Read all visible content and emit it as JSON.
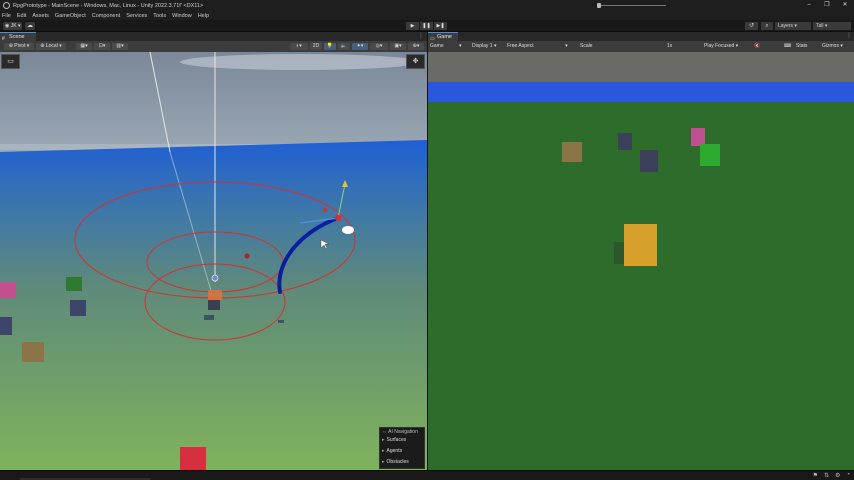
{
  "window": {
    "title": "RpgPrototype - MainScene - Windows, Mac, Linux - Unity 2022.3.71f' <DX11>"
  },
  "menu": [
    "File",
    "Edit",
    "Assets",
    "GameObject",
    "Component",
    "Services",
    "Tools",
    "Window",
    "Help"
  ],
  "toolbar": {
    "account_label": "JK",
    "layers_label": "Layers",
    "layout_label": "Tall"
  },
  "scene_tab": {
    "label": "Scene"
  },
  "game_tab": {
    "label": "Game"
  },
  "scene_toolbar": {
    "pivot_label": "Pivot",
    "space_label": "Local",
    "mode_2d_label": "2D"
  },
  "game_toolbar": {
    "mode_label": "Game",
    "display_label": "Display 1",
    "aspect_label": "Free Aspect",
    "scale_label": "Scale",
    "scale_value": "1x",
    "play_mode_label": "Play Focused",
    "stats_label": "Stats",
    "gizmos_label": "Gizmos"
  },
  "ai_navigation": {
    "title": "AI Navigation",
    "items": [
      "Surfaces",
      "Agents",
      "Obstacles"
    ]
  },
  "colors": {
    "sky": "#2a57dd",
    "ground": "#2e6c2b",
    "accent_tab": "#4c8edb",
    "gizmo_red": "#d53030",
    "path_blue": "#0a1fa0"
  }
}
